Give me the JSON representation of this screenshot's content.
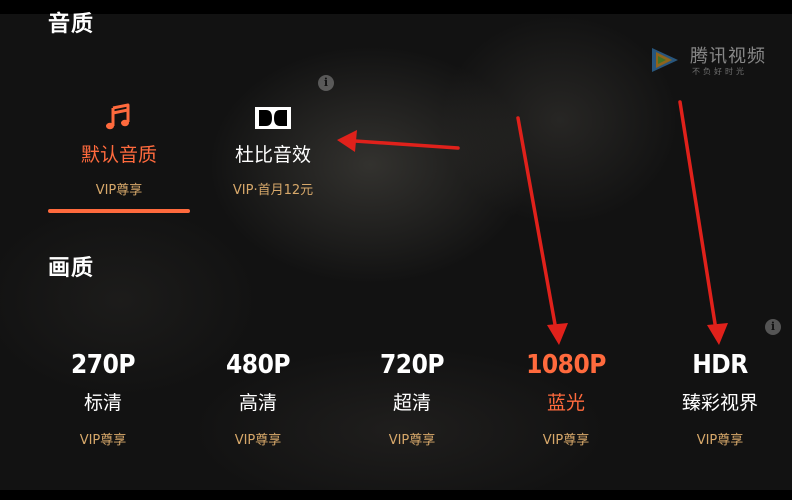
{
  "audio_section": {
    "title": "音质",
    "options": [
      {
        "label": "默认音质",
        "sub": "VIP尊享",
        "icon": "music-note-icon",
        "selected": true
      },
      {
        "label": "杜比音效",
        "sub": "VIP·首月12元",
        "icon": "dolby-icon",
        "selected": false
      }
    ]
  },
  "video_section": {
    "title": "画质",
    "options": [
      {
        "res": "270P",
        "name": "标清",
        "sub": "VIP尊享",
        "selected": false
      },
      {
        "res": "480P",
        "name": "高清",
        "sub": "VIP尊享",
        "selected": false
      },
      {
        "res": "720P",
        "name": "超清",
        "sub": "VIP尊享",
        "selected": false
      },
      {
        "res": "1080P",
        "name": "蓝光",
        "sub": "VIP尊享",
        "selected": true
      },
      {
        "res": "HDR",
        "name": "臻彩视界",
        "sub": "VIP尊享",
        "selected": false
      }
    ]
  },
  "info_icon": "i",
  "watermark": {
    "text": "腾讯视频",
    "sub": "不负好时光"
  },
  "colors": {
    "accent": "#ff6a3d",
    "vip": "#d7a86a",
    "annotation_arrow": "#e0211b"
  }
}
